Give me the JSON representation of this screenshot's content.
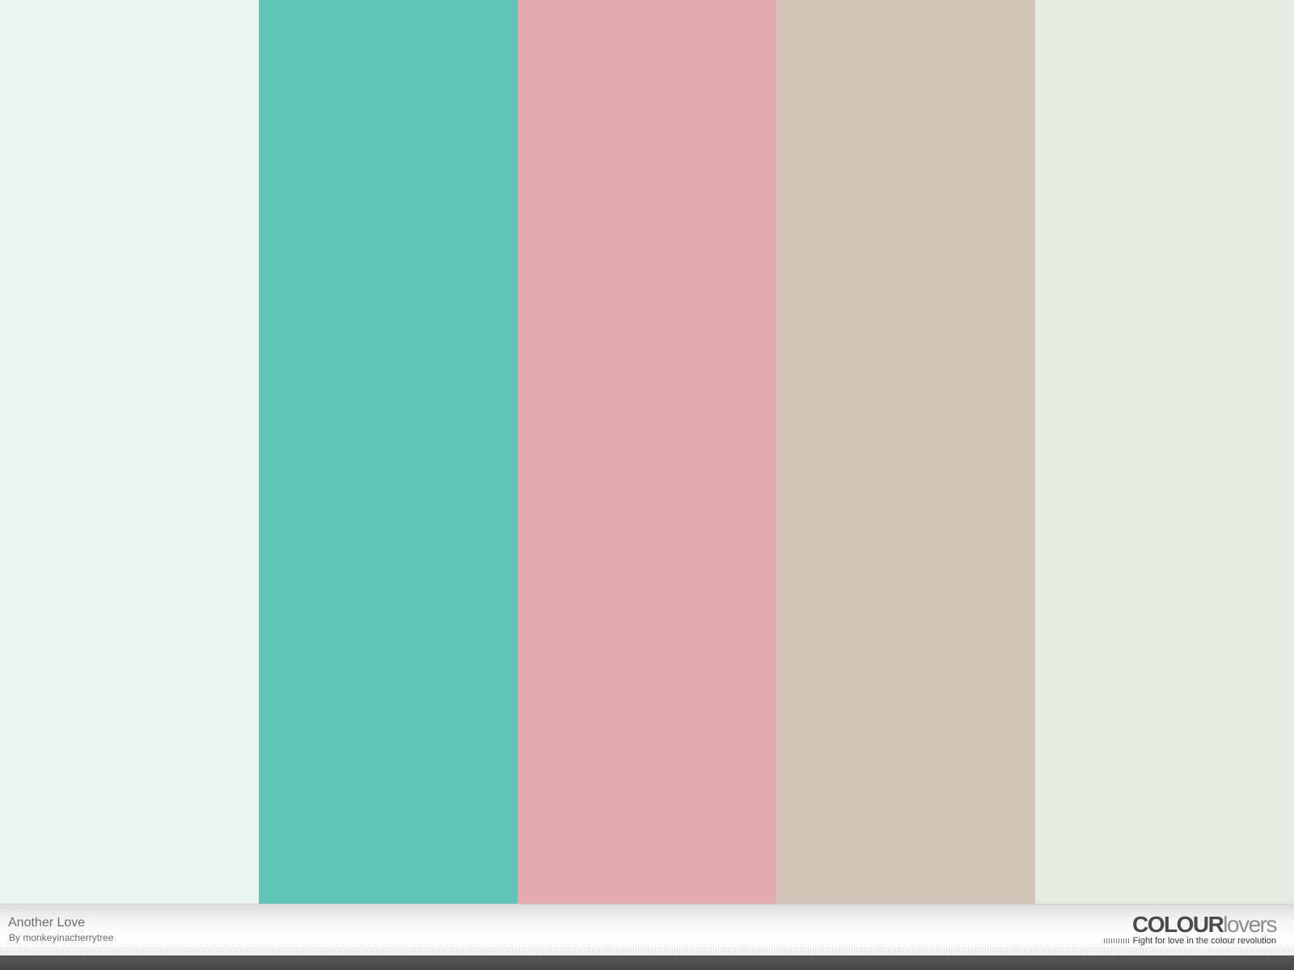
{
  "palette": {
    "title": "Another Love",
    "author": "By monkeyinacherrytree",
    "colors": [
      "#EAF4F1",
      "#62C4B9",
      "#E3ABAF",
      "#D3C6B8",
      "#E6ECE2"
    ]
  },
  "brand": {
    "logo_bold": "COLOUR",
    "logo_light": "lovers",
    "tagline": "Fight for love in the colour revolution"
  }
}
